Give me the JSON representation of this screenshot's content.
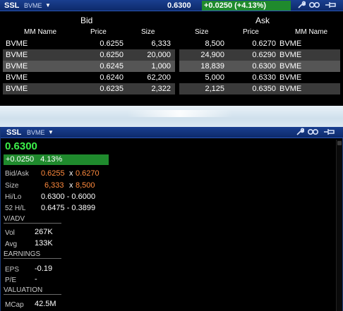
{
  "depth": {
    "symbol": "SSL",
    "source": "BVME",
    "last": "0.6300",
    "change": "+0.0250 (+4.13%)",
    "bid_header": "Bid",
    "ask_header": "Ask",
    "columns": {
      "bid_mm": "MM Name",
      "bid_price": "Price",
      "bid_size": "Size",
      "ask_size": "Size",
      "ask_price": "Price",
      "ask_mm": "MM Name"
    },
    "rows": [
      {
        "bid_mm": "BVME",
        "bid_price": "0.6255",
        "bid_size": "6,333",
        "ask_size": "8,500",
        "ask_price": "0.6270",
        "ask_mm": "BVME"
      },
      {
        "bid_mm": "BVME",
        "bid_price": "0.6250",
        "bid_size": "20,000",
        "ask_size": "24,900",
        "ask_price": "0.6290",
        "ask_mm": "BVME"
      },
      {
        "bid_mm": "BVME",
        "bid_price": "0.6245",
        "bid_size": "1,000",
        "ask_size": "18,839",
        "ask_price": "0.6300",
        "ask_mm": "BVME"
      },
      {
        "bid_mm": "BVME",
        "bid_price": "0.6240",
        "bid_size": "62,200",
        "ask_size": "5,000",
        "ask_price": "0.6330",
        "ask_mm": "BVME"
      },
      {
        "bid_mm": "BVME",
        "bid_price": "0.6235",
        "bid_size": "2,322",
        "ask_size": "2,125",
        "ask_price": "0.6350",
        "ask_mm": "BVME"
      }
    ]
  },
  "quote": {
    "symbol": "SSL",
    "source": "BVME",
    "last": "0.6300",
    "change": "+0.0250",
    "change_pct": "4.13%",
    "bid_ask_label": "Bid/Ask",
    "bid": "0.6255",
    "ask": "0.6270",
    "x": "x",
    "size_label": "Size",
    "bid_size": "6,333",
    "ask_size": "8,500",
    "hilo_label": "Hi/Lo",
    "hilo": "0.6300 - 0.6000",
    "range52_label": "52 H/L",
    "range52": "0.6475 - 0.3899",
    "vadv_section": "V/ADV",
    "vol_label": "Vol",
    "vol": "267K",
    "avg_label": "Avg",
    "avg": "133K",
    "earnings_section": "EARNINGS",
    "eps_label": "EPS",
    "eps": "-0.19",
    "pe_label": "P/E",
    "pe": "-",
    "valuation_section": "VALUATION",
    "mcap_label": "MCap",
    "mcap": "42.5M"
  },
  "colors": {
    "titlebar": "#0d2a6b",
    "change_green": "#1f8a2d",
    "last_green": "#3cf04a",
    "orange": "#ff8a3d",
    "row_dark": "#000000",
    "row_gray": "#3a3a3a",
    "row_highlight": "#555555"
  },
  "icons": [
    "dropdown-caret-icon",
    "wrench-icon",
    "link-icon",
    "pin-icon"
  ]
}
